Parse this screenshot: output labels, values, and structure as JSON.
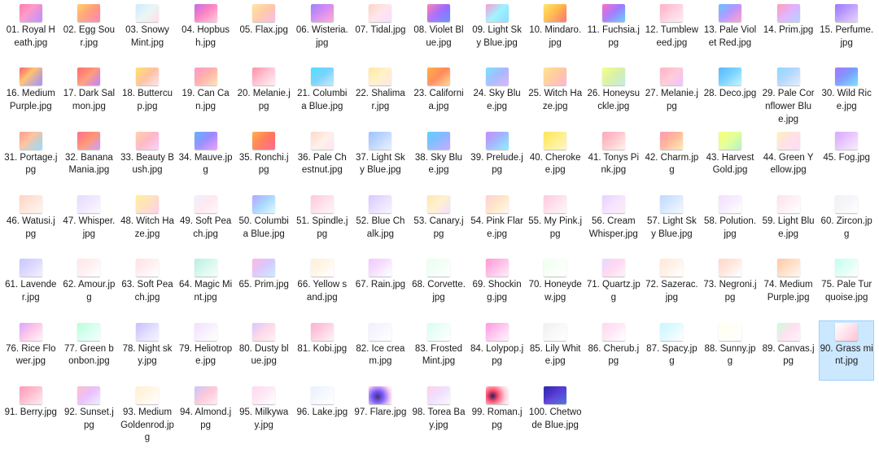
{
  "selected_item": "90. Grass mint.jpg",
  "files": [
    {
      "name": "01. Royal Heath.jpg",
      "thumb": "linear-gradient(135deg,#ff7bac 0%,#ff9ac8 40%,#b37bff 100%)"
    },
    {
      "name": "02. Egg Sour.jpg",
      "thumb": "linear-gradient(135deg,#ffd36b 0%,#ff9e7a 50%,#ff6fae 100%)"
    },
    {
      "name": "03. Snowy Mint.jpg",
      "thumb": "linear-gradient(135deg,#cfe9ff 0%,#e9f7f4 50%,#ffd8e8 100%)"
    },
    {
      "name": "04. Hopbush.jpg",
      "thumb": "linear-gradient(135deg,#c66ce6 0%,#ff84c0 50%,#ffc0d8 100%)"
    },
    {
      "name": "05. Flax.jpg",
      "thumb": "linear-gradient(135deg,#ffe7a0 0%,#ffc8a8 50%,#f8b0e6 100%)"
    },
    {
      "name": "06. Wisteria.jpg",
      "thumb": "linear-gradient(135deg,#9d85ff 0%,#d78cf0 50%,#ff9bd0 100%)"
    },
    {
      "name": "07. Tidal.jpg",
      "thumb": "linear-gradient(135deg,#ffd3c4 0%,#ffe6ea 50%,#f7d6ff 100%)"
    },
    {
      "name": "08. Violet Blue.jpg",
      "thumb": "linear-gradient(135deg,#ff85b2 0%,#a26bff 50%,#4a7bff 100%)"
    },
    {
      "name": "09. Light Sky Blue.jpg",
      "thumb": "linear-gradient(135deg,#ff9bd6 0%,#9df3ff 50%,#7ad6ff 100%)"
    },
    {
      "name": "10. Mindaro.jpg",
      "thumb": "linear-gradient(135deg,#ffe86a 0%,#ffb64a 50%,#ff5a5a 100%)"
    },
    {
      "name": "11. Fuchsia.jpg",
      "thumb": "linear-gradient(135deg,#ff6bc9 0%,#9f7bff 50%,#4bc4ff 100%)"
    },
    {
      "name": "12. Tumbleweed.jpg",
      "thumb": "linear-gradient(135deg,#ffb0c6 0%,#ffd0e0 50%,#ffe8ef 100%)"
    },
    {
      "name": "13. Pale Violet Red.jpg",
      "thumb": "linear-gradient(135deg,#63c7ff 0%,#b894ff 50%,#ff8fc0 100%)"
    },
    {
      "name": "14. Prim.jpg",
      "thumb": "linear-gradient(135deg,#ff9fb5 0%,#e0b3ff 50%,#a5c8ff 100%)"
    },
    {
      "name": "15. Perfume.jpg",
      "thumb": "linear-gradient(135deg,#9a7bff 0%,#bfa1ff 50%,#e0c8ff 100%)"
    },
    {
      "name": "16. Medium Purple.jpg",
      "thumb": "linear-gradient(135deg,#ff5f6d 0%,#ffc371 40%,#8f7bff 100%)"
    },
    {
      "name": "17. Dark Salmon.jpg",
      "thumb": "linear-gradient(135deg,#ff6e6e 0%,#ff9b7a 50%,#b46dff 100%)"
    },
    {
      "name": "18. Buttercup.jpg",
      "thumb": "linear-gradient(135deg,#ffe36b 0%,#ffc0a0 50%,#ffdce6 100%)"
    },
    {
      "name": "19. Can Can.jpg",
      "thumb": "linear-gradient(135deg,#ff9ad0 0%,#ffb0a8 50%,#ffe0a8 100%)"
    },
    {
      "name": "20. Melanie.jpg",
      "thumb": "linear-gradient(135deg,#ff8fa8 0%,#ffc6d3 50%,#ffe8f0 100%)"
    },
    {
      "name": "21. Columbia Blue.jpg",
      "thumb": "linear-gradient(135deg,#4ee0ff 0%,#7ad2ff 50%,#b5e6ff 100%)"
    },
    {
      "name": "22. Shalimar.jpg",
      "thumb": "linear-gradient(135deg,#ffe9a0 0%,#fff2c8 50%,#ffe0e6 100%)"
    },
    {
      "name": "23. California.jpg",
      "thumb": "linear-gradient(135deg,#ffb347 0%,#ff8a5b 50%,#ffcc80 100%)"
    },
    {
      "name": "24. Sky Blue.jpg",
      "thumb": "linear-gradient(135deg,#7de2ff 0%,#a6b9ff 50%,#d4a8ff 100%)"
    },
    {
      "name": "25. Witch Haze.jpg",
      "thumb": "linear-gradient(135deg,#ffe58f 0%,#ffc9a0 50%,#ffa8c8 100%)"
    },
    {
      "name": "26. Honeysuckle.jpg",
      "thumb": "linear-gradient(135deg,#f6ff8a 0%,#d8f0a8 50%,#b8e8d8 100%)"
    },
    {
      "name": "27. Melanie.jpg",
      "thumb": "linear-gradient(135deg,#ffb3c7 0%,#ffcbd8 50%,#e8b8ff 100%)"
    },
    {
      "name": "28. Deco.jpg",
      "thumb": "linear-gradient(135deg,#5ab8ff 0%,#7ad4ff 50%,#b8f0ff 100%)"
    },
    {
      "name": "29. Pale Cornflower Blue.jpg",
      "thumb": "linear-gradient(135deg,#8fd8ff 0%,#b5d8ff 50%,#dfe8ff 100%)"
    },
    {
      "name": "30. Wild Rice.jpg",
      "thumb": "linear-gradient(135deg,#a877ff 0%,#7a9bff 50%,#64d8ff 100%)"
    },
    {
      "name": "31. Portage.jpg",
      "thumb": "linear-gradient(135deg,#ff9a8b 0%,#ffc3a0 40%,#7dd6ff 100%)"
    },
    {
      "name": "32. Banana Mania.jpg",
      "thumb": "linear-gradient(135deg,#ff6f91 0%,#ff9671 50%,#c48bff 100%)"
    },
    {
      "name": "33. Beauty Bush.jpg",
      "thumb": "linear-gradient(135deg,#ffd1a8 0%,#ffb8c6 50%,#f7c8ff 100%)"
    },
    {
      "name": "34. Mauve.jpg",
      "thumb": "linear-gradient(135deg,#5fb6ff 0%,#9a8bff 50%,#e98bff 100%)"
    },
    {
      "name": "35. Ronchi.jpg",
      "thumb": "linear-gradient(135deg,#ffb24d 0%,#ff7a5a 50%,#ff4e7a 100%)"
    },
    {
      "name": "36. Pale Chestnut.jpg",
      "thumb": "linear-gradient(135deg,#ffd8c8 0%,#fff0e8 50%,#ffe0f0 100%)"
    },
    {
      "name": "37. Light Sky Blue.jpg",
      "thumb": "linear-gradient(135deg,#9ec3ff 0%,#c0d8ff 50%,#e4ecff 100%)"
    },
    {
      "name": "38. Sky Blue.jpg",
      "thumb": "linear-gradient(135deg,#5fd1ff 0%,#8ab8ff 50%,#b89cff 100%)"
    },
    {
      "name": "39. Prelude.jpg",
      "thumb": "linear-gradient(135deg,#c88bff 0%,#9fb8ff 50%,#7de8ff 100%)"
    },
    {
      "name": "40. Cherokee.jpg",
      "thumb": "linear-gradient(135deg,#ffe45a 0%,#ffef8a 50%,#fff3b8 100%)"
    },
    {
      "name": "41. Tonys Pink.jpg",
      "thumb": "linear-gradient(135deg,#ffa8b8 0%,#ffc8d0 50%,#fff0e0 100%)"
    },
    {
      "name": "42. Charm.jpg",
      "thumb": "linear-gradient(135deg,#ff9ab0 0%,#ffb89a 50%,#ffe6a8 100%)"
    },
    {
      "name": "43. Harvest Gold.jpg",
      "thumb": "linear-gradient(135deg,#f8ff7a 0%,#e2ff9a 50%,#a8f0b8 100%)"
    },
    {
      "name": "44. Green Yellow.jpg",
      "thumb": "linear-gradient(135deg,#fff1b8 0%,#ffe0e8 50%,#ffd6f0 100%)"
    },
    {
      "name": "45. Fog.jpg",
      "thumb": "linear-gradient(135deg,#d7a8ff 0%,#e8c8ff 50%,#f6e6ff 100%)"
    },
    {
      "name": "46. Watusi.jpg",
      "thumb": "linear-gradient(135deg,#ffd3c0 0%,#ffe6dc 50%,#fff2ea 100%)"
    },
    {
      "name": "47. Whisper.jpg",
      "thumb": "linear-gradient(135deg,#e6dcff 0%,#f0e8ff 50%,#fbf6ff 100%)"
    },
    {
      "name": "48. Witch Haze.jpg",
      "thumb": "linear-gradient(135deg,#fff09a 0%,#ffe0c0 50%,#ffc8e0 100%)"
    },
    {
      "name": "49. Soft Peach.jpg",
      "thumb": "linear-gradient(135deg,#f0f0ff 0%,#ffe8f0 50%,#fff6f6 100%)"
    },
    {
      "name": "50. Columbia Blue.jpg",
      "thumb": "linear-gradient(135deg,#b5a8ff 0%,#a8d8ff 50%,#d8f6ff 100%)"
    },
    {
      "name": "51. Spindle.jpg",
      "thumb": "linear-gradient(135deg,#ffc8d8 0%,#ffe0ea 50%,#fff2f6 100%)"
    },
    {
      "name": "52. Blue Chalk.jpg",
      "thumb": "linear-gradient(135deg,#d8c8ff 0%,#e8e0ff 50%,#f6f2ff 100%)"
    },
    {
      "name": "53. Canary.jpg",
      "thumb": "linear-gradient(135deg,#ffe8b0 0%,#fff0d0 50%,#f0d8ff 100%)"
    },
    {
      "name": "54. Pink Flare.jpg",
      "thumb": "linear-gradient(135deg,#ffd0d8 0%,#ffe6c8 50%,#fff6e6 100%)"
    },
    {
      "name": "55. My Pink.jpg",
      "thumb": "linear-gradient(135deg,#ffc8e0 0%,#ffe0ec 50%,#fff4f8 100%)"
    },
    {
      "name": "56. Cream Whisper.jpg",
      "thumb": "linear-gradient(135deg,#e6d0ff 0%,#f4e4ff 50%,#ffe8f4 100%)"
    },
    {
      "name": "57. Light Sky Blue.jpg",
      "thumb": "linear-gradient(135deg,#c0d8ff 0%,#d8e8ff 50%,#f0f6ff 100%)"
    },
    {
      "name": "58. Polution.jpg",
      "thumb": "linear-gradient(135deg,#f2e0ff 0%,#f8ecff 50%,#ffffff 100%)"
    },
    {
      "name": "59. Light Blue.jpg",
      "thumb": "linear-gradient(135deg,#ffe0ee 0%,#fff0f4 50%,#ffffff 100%)"
    },
    {
      "name": "60. Zircon.jpg",
      "thumb": "linear-gradient(135deg,#f0f0f6 0%,#f6f6fa 50%,#ffffff 100%)"
    },
    {
      "name": "61. Lavender.jpg",
      "thumb": "linear-gradient(135deg,#c8c8ff 0%,#dcd8ff 50%,#f0ecff 100%)"
    },
    {
      "name": "62. Amour.jpg",
      "thumb": "linear-gradient(135deg,#ffe6ea 0%,#fff0f2 50%,#ffffff 100%)"
    },
    {
      "name": "63. Soft Peach.jpg",
      "thumb": "linear-gradient(135deg,#ffe0e6 0%,#fff0f0 50%,#ffffff 100%)"
    },
    {
      "name": "64. Magic Mint.jpg",
      "thumb": "linear-gradient(135deg,#b8f0e0 0%,#d8f8f0 50%,#f0fff8 100%)"
    },
    {
      "name": "65. Prim.jpg",
      "thumb": "linear-gradient(135deg,#ffb8e0 0%,#d8c8ff 50%,#c0e8ff 100%)"
    },
    {
      "name": "66. Yellow sand.jpg",
      "thumb": "linear-gradient(135deg,#fff0d8 0%,#fff6e8 50%,#ffffff 100%)"
    },
    {
      "name": "67. Rain.jpg",
      "thumb": "linear-gradient(135deg,#f0c8ff 0%,#f6e0ff 50%,#ffffff 100%)"
    },
    {
      "name": "68. Corvette.jpg",
      "thumb": "linear-gradient(135deg,#e8fff0 0%,#f2fff6 50%,#ffffff 100%)"
    },
    {
      "name": "69. Shocking.jpg",
      "thumb": "linear-gradient(135deg,#ff9ad8 0%,#ffc0e8 50%,#ffe8f6 100%)"
    },
    {
      "name": "70. Honeydew.jpg",
      "thumb": "linear-gradient(135deg,#f0fff0 0%,#f8fff8 50%,#ffffff 100%)"
    },
    {
      "name": "71. Quartz.jpg",
      "thumb": "linear-gradient(135deg,#e8d8ff 0%,#ffd8f0 50%,#fff0f8 100%)"
    },
    {
      "name": "72. Sazerac.jpg",
      "thumb": "linear-gradient(135deg,#ffe8d8 0%,#fff2e8 50%,#ffffff 100%)"
    },
    {
      "name": "73. Negroni.jpg",
      "thumb": "linear-gradient(135deg,#ffd8c8 0%,#ffe8e0 50%,#ffffff 100%)"
    },
    {
      "name": "74. Medium Purple.jpg",
      "thumb": "linear-gradient(135deg,#ffc8a8 0%,#ffe0c8 50%,#fff4ea 100%)"
    },
    {
      "name": "75. Pale Turquoise.jpg",
      "thumb": "linear-gradient(135deg,#c0fff0 0%,#e0fff6 50%,#ffffff 100%)"
    },
    {
      "name": "76. Rice Flower.jpg",
      "thumb": "linear-gradient(135deg,#d8a8ff 0%,#ffc8e8 50%,#fff0f8 100%)"
    },
    {
      "name": "77. Green bonbon.jpg",
      "thumb": "linear-gradient(135deg,#b8ffd8 0%,#d8fff0 50%,#f0fffa 100%)"
    },
    {
      "name": "78. Night sky.jpg",
      "thumb": "linear-gradient(135deg,#c8c0ff 0%,#e0dcff 50%,#f4f2ff 100%)"
    },
    {
      "name": "79. Heliotrope.jpg",
      "thumb": "linear-gradient(135deg,#f0e0ff 0%,#f8f0ff 50%,#ffffff 100%)"
    },
    {
      "name": "80. Dusty blue.jpg",
      "thumb": "linear-gradient(135deg,#d8c8ff 0%,#ffd8e8 50%,#ffeef4 100%)"
    },
    {
      "name": "81. Kobi.jpg",
      "thumb": "linear-gradient(135deg,#ffb0d0 0%,#ffd0e4 50%,#fff0f6 100%)"
    },
    {
      "name": "82. Ice cream.jpg",
      "thumb": "linear-gradient(135deg,#f0f0ff 0%,#f8f6ff 50%,#ffffff 100%)"
    },
    {
      "name": "83. Frosted Mint.jpg",
      "thumb": "linear-gradient(135deg,#d8fff0 0%,#ecfff8 50%,#ffffff 100%)"
    },
    {
      "name": "84. Lolypop.jpg",
      "thumb": "linear-gradient(135deg,#ff9ae0 0%,#ffc8f0 50%,#fff0fa 100%)"
    },
    {
      "name": "85. Lily White.jpg",
      "thumb": "linear-gradient(135deg,#f0f0f0 0%,#f8f8f8 50%,#ffffff 100%)"
    },
    {
      "name": "86. Cherub.jpg",
      "thumb": "linear-gradient(135deg,#ffd8f0 0%,#ffe8f6 50%,#ffffff 100%)"
    },
    {
      "name": "87. Spacy.jpg",
      "thumb": "linear-gradient(135deg,#c8f6ff 0%,#e0faff 50%,#ffffff 100%)"
    },
    {
      "name": "88. Sunny.jpg",
      "thumb": "linear-gradient(135deg,#fffff0 0%,#fffff6 50%,#ffffff 100%)"
    },
    {
      "name": "89. Canvas.jpg",
      "thumb": "linear-gradient(135deg,#c8ffd8 0%,#ffe0f0 50%,#fff0f8 100%)"
    },
    {
      "name": "90. Grass mint.jpg",
      "thumb": "linear-gradient(135deg,#ffffff 0%,#ffe6ee 45%,#ffb8cc 100%)"
    },
    {
      "name": "91. Berry.jpg",
      "thumb": "linear-gradient(135deg,#ff9ab8 0%,#ffc0d0 50%,#ffe6ee 100%)"
    },
    {
      "name": "92. Sunset.jpg",
      "thumb": "linear-gradient(135deg,#ffc0c8 0%,#e8c0ff 50%,#f0e8ff 100%)"
    },
    {
      "name": "93. Medium Goldenrod.jpg",
      "thumb": "linear-gradient(135deg,#fff0d0 0%,#fff6e6 50%,#ffffff 100%)"
    },
    {
      "name": "94. Almond.jpg",
      "thumb": "linear-gradient(135deg,#c8c8ff 0%,#ffc8d8 50%,#ffe8f0 100%)"
    },
    {
      "name": "95. Milkyway.jpg",
      "thumb": "linear-gradient(135deg,#ffd8f0 0%,#ffe8f6 50%,#ffffff 100%)"
    },
    {
      "name": "96. Lake.jpg",
      "thumb": "linear-gradient(135deg,#e8f0ff 0%,#f4f8ff 50%,#ffffff 100%)"
    },
    {
      "name": "97. Flare.jpg",
      "thumb": "radial-gradient(circle at 40% 60%,#3a2a7a 0%,#7a5aff 35%,#ffd0f0 75%,#ffffff 100%)"
    },
    {
      "name": "98. Torea Bay.jpg",
      "thumb": "linear-gradient(135deg,#ffd0e8 0%,#f0e0ff 50%,#f8f6ff 100%)"
    },
    {
      "name": "99. Roman.jpg",
      "thumb": "radial-gradient(circle at 30% 55%,#2a1a5a 0%,#ff4a6a 30%,#ffc8d8 65%,#ffffff 100%)"
    },
    {
      "name": "100. Chetwode Blue.jpg",
      "thumb": "linear-gradient(135deg,#2a2aa8 0%,#5a3ad8 50%,#2a5ad0 100%)"
    }
  ]
}
